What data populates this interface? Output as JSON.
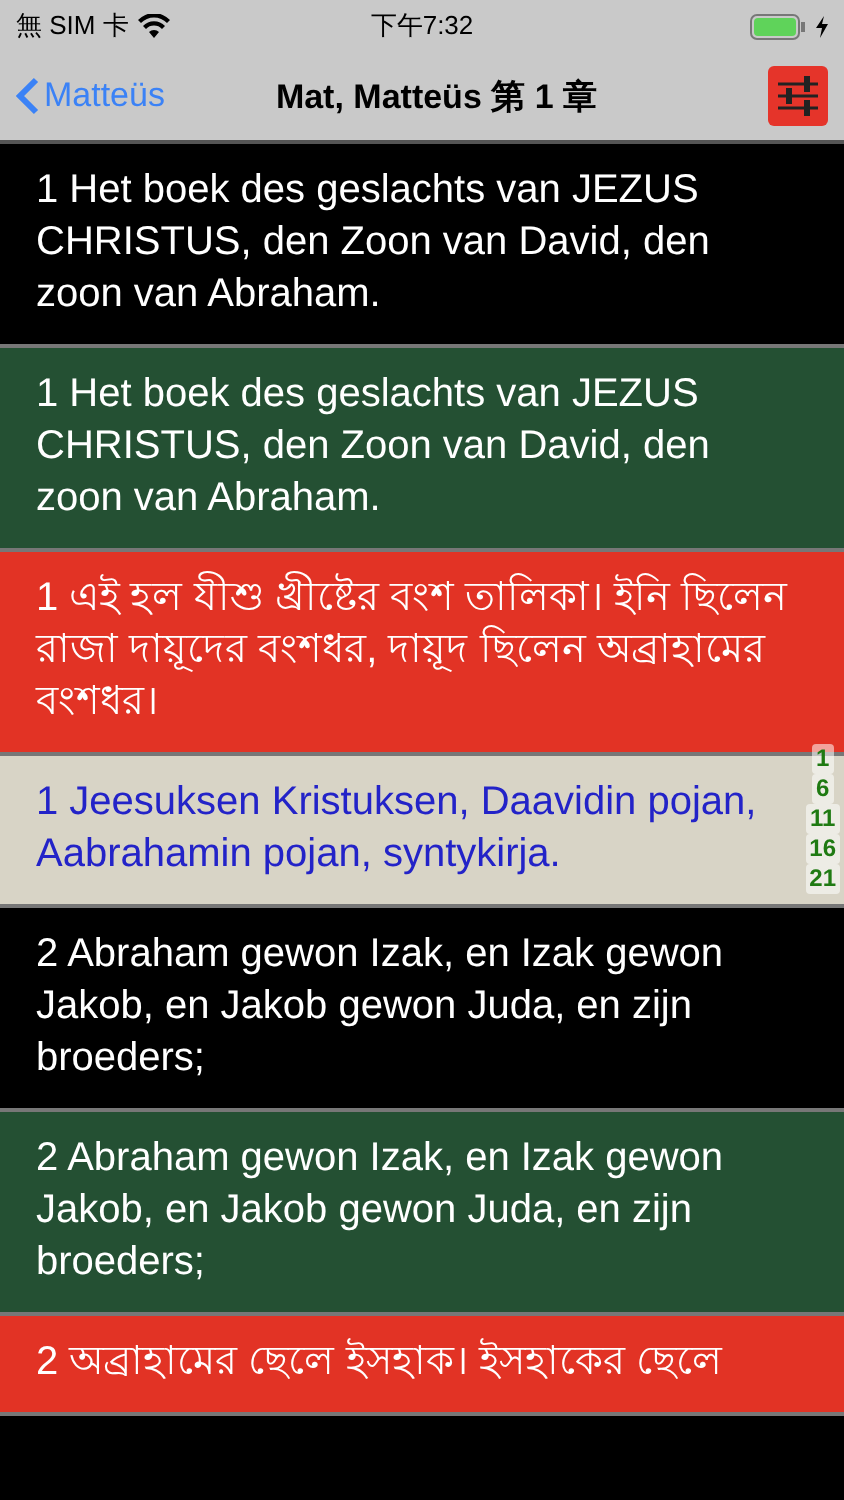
{
  "status_bar": {
    "carrier": "無 SIM 卡",
    "time": "下午7:32"
  },
  "nav": {
    "back": "Matteüs",
    "title": "Mat, Matteüs 第 1 章"
  },
  "verses": [
    {
      "text": "1 Het boek des geslachts van JEZUS CHRISTUS, den Zoon van David, den zoon van Abraham.",
      "color": "#000000",
      "kind": "light"
    },
    {
      "text": "1 Het boek des geslachts van JEZUS CHRISTUS, den Zoon van David, den zoon van Abraham.",
      "color": "#245033",
      "kind": "light"
    },
    {
      "text": "1 এই হল যীশু খ্রীষ্টের বংশ তালিকা। ইনি ছিলেন রাজা দায়ূদের বংশধর, দায়ূদ ছিলেন অব্রাহামের বংশধর।",
      "color": "#e23325",
      "kind": "light"
    },
    {
      "text": "1 Jeesuksen Kristuksen, Daavidin pojan, Aabrahamin pojan, syntykirja.",
      "color": "#d8d4c6",
      "kind": "dark"
    },
    {
      "text": "2 Abraham gewon Izak, en Izak gewon Jakob, en Jakob gewon Juda, en zijn broeders;",
      "color": "#000000",
      "kind": "light"
    },
    {
      "text": "2 Abraham gewon Izak, en Izak gewon Jakob, en Jakob gewon Juda, en zijn broeders;",
      "color": "#245033",
      "kind": "light"
    },
    {
      "text": "2 অব্রাহামের ছেলে ইসহাক। ইসহাকের ছেলে",
      "color": "#e23325",
      "kind": "light"
    }
  ],
  "verse_index": [
    "1",
    "6",
    "11",
    "16",
    "21"
  ]
}
